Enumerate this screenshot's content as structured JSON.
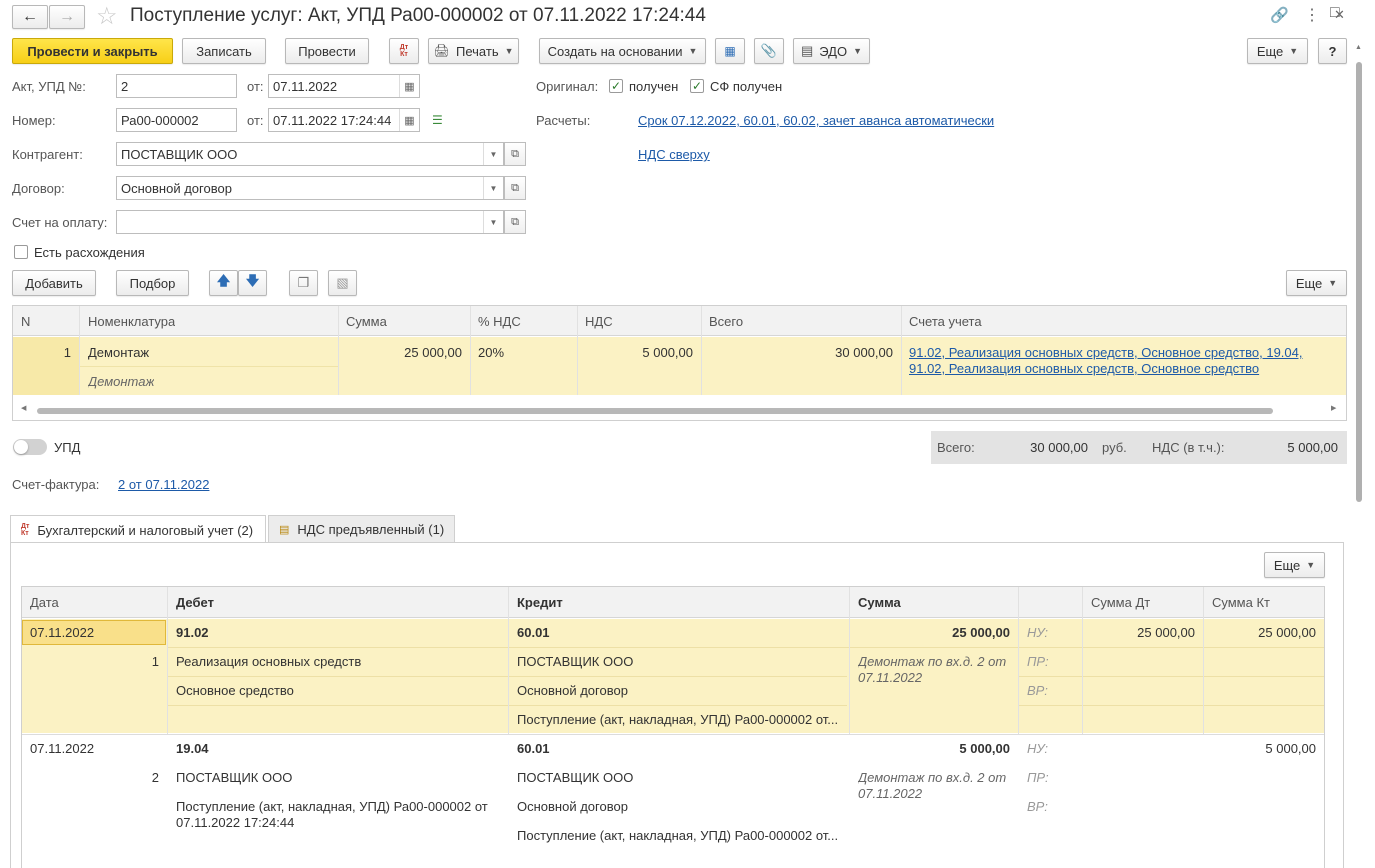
{
  "title": "Поступление услуг: Акт, УПД Ра00-000002 от 07.11.2022 17:24:44",
  "toolbar": {
    "post_close": "Провести и закрыть",
    "save": "Записать",
    "post": "Провести",
    "dtkt": "Дт Кт",
    "print": "Печать",
    "create_based": "Создать на основании",
    "edo": "ЭДО",
    "more": "Еще",
    "help": "?"
  },
  "header": {
    "act_label": "Акт, УПД №:",
    "act_value": "2",
    "from_label": "от:",
    "act_date": "07.11.2022",
    "number_label": "Номер:",
    "number_value": "Ра00-000002",
    "from_label2": "от:",
    "number_date": "07.11.2022 17:24:44",
    "original_label": "Оригинал:",
    "received": "получен",
    "sf_received": "СФ получен",
    "settlements_label": "Расчеты:",
    "settlements_link": "Срок 07.12.2022, 60.01, 60.02, зачет аванса автоматически",
    "vat_link": "НДС сверху",
    "counterparty_label": "Контрагент:",
    "counterparty_value": "ПОСТАВЩИК ООО",
    "contract_label": "Договор:",
    "contract_value": "Основной договор",
    "invoice_label": "Счет на оплату:",
    "invoice_value": "",
    "discrepancy": "Есть расхождения"
  },
  "table_toolbar": {
    "add": "Добавить",
    "pick": "Подбор",
    "more": "Еще"
  },
  "items_table": {
    "columns": [
      "N",
      "Номенклатура",
      "Сумма",
      "% НДС",
      "НДС",
      "Всего",
      "Счета учета"
    ],
    "rows": [
      {
        "n": "1",
        "name": "Демонтаж",
        "name2": "Демонтаж",
        "sum": "25 000,00",
        "vat_rate": "20%",
        "vat": "5 000,00",
        "total": "30 000,00",
        "accounts1": "91.02, Реализация основных средств, Основное средство, 19.04,",
        "accounts2": "91.02, Реализация основных средств, Основное средство"
      }
    ]
  },
  "totals": {
    "upd_label": "УПД",
    "total_label": "Всего:",
    "total_value": "30 000,00",
    "currency": "руб.",
    "vat_label": "НДС (в т.ч.):",
    "vat_value": "5 000,00"
  },
  "invoice": {
    "label": "Счет-фактура:",
    "link": "2 от 07.11.2022"
  },
  "tabs": [
    {
      "label": "Бухгалтерский и налоговый учет (2)"
    },
    {
      "label": "НДС предъявленный (1)"
    }
  ],
  "entries": {
    "more": "Еще",
    "columns": [
      "Дата",
      "Дебет",
      "Кредит",
      "Сумма",
      "",
      "Сумма Дт",
      "Сумма Кт"
    ],
    "rows": [
      {
        "date": "07.11.2022",
        "n": "1",
        "debit_acc": "91.02",
        "debit_1": "Реализация основных средств",
        "debit_2": "Основное средство",
        "debit_3": "",
        "credit_acc": "60.01",
        "credit_1": "ПОСТАВЩИК ООО",
        "credit_2": "Основной договор",
        "credit_3": "Поступление (акт, накладная, УПД) Ра00-000002 от...",
        "sum": "25 000,00",
        "content": "Демонтаж по вх.д. 2 от",
        "content2": "07.11.2022",
        "nu": "НУ:",
        "pr": "ПР:",
        "vr": "ВР:",
        "sum_dt": "25 000,00",
        "sum_kt": "25 000,00"
      },
      {
        "date": "07.11.2022",
        "n": "2",
        "debit_acc": "19.04",
        "debit_1": "ПОСТАВЩИК ООО",
        "debit_2": "Поступление (акт, накладная, УПД) Ра00-000002 от",
        "debit_3": "07.11.2022 17:24:44",
        "credit_acc": "60.01",
        "credit_1": "ПОСТАВЩИК ООО",
        "credit_2": "Основной договор",
        "credit_3": "Поступление (акт, накладная, УПД) Ра00-000002 от...",
        "sum": "5 000,00",
        "content": "Демонтаж по вх.д. 2 от",
        "content2": "07.11.2022",
        "nu": "НУ:",
        "pr": "ПР:",
        "vr": "ВР:",
        "sum_dt": "",
        "sum_kt": "5 000,00"
      }
    ]
  },
  "colors": {
    "accent_yellow": "#f7cf17",
    "row_highlight": "#fbf2c4",
    "link": "#1d5aa8"
  }
}
